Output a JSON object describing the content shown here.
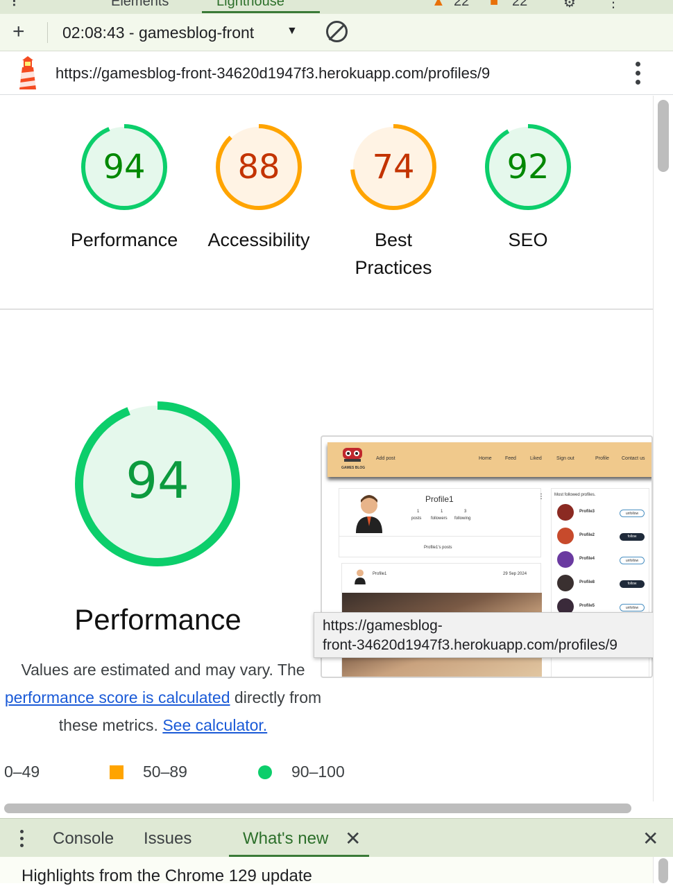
{
  "devtools": {
    "tabs": [
      "Elements",
      "Lighthouse"
    ],
    "badges": {
      "errors": "22",
      "warnings": "22"
    }
  },
  "toolbar": {
    "report_label": "02:08:43 - gamesblog-front"
  },
  "url": "https://gamesblog-front-34620d1947f3.herokuapp.com/profiles/9",
  "categories": [
    {
      "label": "Performance",
      "score": 94,
      "level": "pass"
    },
    {
      "label": "Accessibility",
      "score": 88,
      "level": "average"
    },
    {
      "label": "Best Practices",
      "score": 74,
      "level": "average"
    },
    {
      "label": "SEO",
      "score": 92,
      "level": "pass"
    }
  ],
  "performance": {
    "score": 94,
    "title": "Performance",
    "desc_1": "Values are estimated and may vary. The",
    "link_1": "performance score is calculated",
    "desc_2": "directly from",
    "desc_3": "these metrics.",
    "link_2": "See calculator."
  },
  "legend": [
    {
      "range": "0–49",
      "shape": "triangle",
      "color": "#ff4e42"
    },
    {
      "range": "50–89",
      "shape": "square",
      "color": "#ffa400"
    },
    {
      "range": "90–100",
      "shape": "circle",
      "color": "#0cce6b"
    }
  ],
  "colors": {
    "pass": "#0cce6b",
    "pass_text": "#008800",
    "pass_fill": "#e5f8ec",
    "average": "#ffa400",
    "average_text": "#c33300",
    "average_fill": "#fff3e4"
  },
  "thumbnail": {
    "nav": [
      "Add post",
      "Home",
      "Feed",
      "Liked",
      "Sign out",
      "Profile",
      "Contact us"
    ],
    "profile_name": "Profile1",
    "stats": [
      "1",
      "1",
      "3"
    ],
    "stat_labels": [
      "posts",
      "followers",
      "following"
    ],
    "posts_heading": "Profile1's posts",
    "post_author": "Profile1",
    "post_date": "29 Sep 2024",
    "sidebar_title": "Most followed profiles.",
    "profiles": [
      {
        "name": "Profile3",
        "action": "unfollow"
      },
      {
        "name": "Profile2",
        "action": "follow"
      },
      {
        "name": "Profile4",
        "action": "unfollow"
      },
      {
        "name": "Profile8",
        "action": "follow"
      },
      {
        "name": "Profile5",
        "action": "unfollow"
      }
    ]
  },
  "tooltip": {
    "line1": "https://gamesblog-",
    "line2": "front-34620d1947f3.herokuapp.com/profiles/9"
  },
  "drawer": {
    "tabs": [
      "Console",
      "Issues",
      "What's new"
    ],
    "body": "Highlights from the Chrome 129 update"
  }
}
